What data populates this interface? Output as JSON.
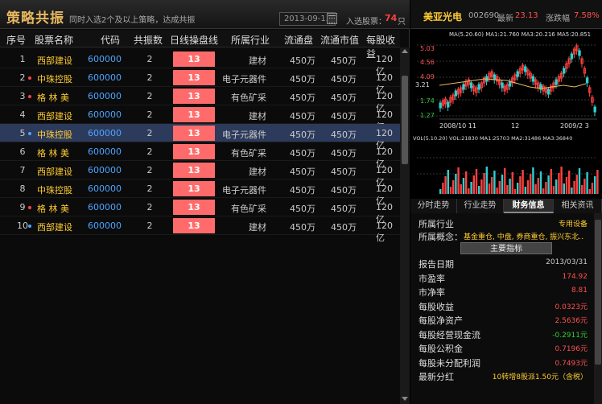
{
  "header": {
    "title": "策略共振",
    "subtitle": "同时入选2个及以上策略，达成共振",
    "date": "2013-09-13",
    "selected_label": "入选股票：",
    "selected_count": "74",
    "selected_unit": "只"
  },
  "columns": [
    "序号",
    "股票名称",
    "代码",
    "共振数",
    "日线操盘线",
    "所属行业",
    "流通盘",
    "流通市值",
    "每股收益"
  ],
  "rows": [
    {
      "idx": "1",
      "dot": "",
      "name": "西部建设",
      "code": "600000",
      "amp": "2",
      "op": "13",
      "industry": "建材",
      "float": "450万",
      "mv": "450万",
      "eps": "120亿"
    },
    {
      "idx": "2",
      "dot": "#ff4444",
      "name": "中珠控股",
      "code": "600000",
      "amp": "2",
      "op": "13",
      "industry": "电子元器件",
      "float": "450万",
      "mv": "450万",
      "eps": "120亿"
    },
    {
      "idx": "3",
      "dot": "#ff4444",
      "name": "格 林 美",
      "code": "600000",
      "amp": "2",
      "op": "13",
      "industry": "有色矿采",
      "float": "450万",
      "mv": "450万",
      "eps": "120亿"
    },
    {
      "idx": "4",
      "dot": "",
      "name": "西部建设",
      "code": "600000",
      "amp": "2",
      "op": "13",
      "industry": "建材",
      "float": "450万",
      "mv": "450万",
      "eps": "120亿"
    },
    {
      "idx": "5",
      "dot": "#4ea4ff",
      "name": "中珠控股",
      "code": "600000",
      "amp": "2",
      "op": "13",
      "industry": "电子元器件",
      "float": "450万",
      "mv": "450万",
      "eps": "120亿"
    },
    {
      "idx": "6",
      "dot": "",
      "name": "格 林 美",
      "code": "600000",
      "amp": "2",
      "op": "13",
      "industry": "有色矿采",
      "float": "450万",
      "mv": "450万",
      "eps": "120亿"
    },
    {
      "idx": "7",
      "dot": "",
      "name": "西部建设",
      "code": "600000",
      "amp": "2",
      "op": "13",
      "industry": "建材",
      "float": "450万",
      "mv": "450万",
      "eps": "120亿"
    },
    {
      "idx": "8",
      "dot": "",
      "name": "中珠控股",
      "code": "600000",
      "amp": "2",
      "op": "13",
      "industry": "电子元器件",
      "float": "450万",
      "mv": "450万",
      "eps": "120亿"
    },
    {
      "idx": "9",
      "dot": "#ff4444",
      "name": "格 林 美",
      "code": "600000",
      "amp": "2",
      "op": "13",
      "industry": "有色矿采",
      "float": "450万",
      "mv": "450万",
      "eps": "120亿"
    },
    {
      "idx": "10",
      "dot": "#4ea4ff",
      "name": "西部建设",
      "code": "600000",
      "amp": "2",
      "op": "13",
      "industry": "建材",
      "float": "450万",
      "mv": "450万",
      "eps": "120亿"
    }
  ],
  "selected_row": 5,
  "stock": {
    "name": "美亚光电",
    "code": "002690",
    "last_label": "最新",
    "last": "23.13",
    "chg_label": "涨跌幅",
    "chg": "7.58%"
  },
  "kline": {
    "ma_line": "MA(5.20.60) MA1:21.760 MA3:20.216 MA5:20.851",
    "prices": [
      "5.03",
      "4.56",
      "4.09",
      "3.21",
      "1.74",
      "1.27"
    ],
    "dates": [
      "2008/10 11",
      "12",
      "2009/2 3"
    ],
    "vol_line": "VOL(5.10.20) VOL:21830 MA1:25703 MA2:31486 MA3:36840"
  },
  "tabs": [
    "分时走势",
    "行业走势",
    "财务信息",
    "相关资讯"
  ],
  "active_tab": 2,
  "info": {
    "industry_label": "所属行业",
    "industry": "专用设备",
    "concept_label": "所属概念：",
    "concept": "基金重仓, 中盘, 券商重仓, 振兴东北...",
    "section": "主要指标",
    "items": [
      {
        "label": "报告日期",
        "value": "2013/03/31",
        "color": "#ccc"
      },
      {
        "label": "市盈率",
        "value": "174.92",
        "color": "#ff5050"
      },
      {
        "label": "市净率",
        "value": "8.81",
        "color": "#ff5050"
      },
      {
        "label": "每股收益",
        "value": "0.0323元",
        "color": "#ff5050"
      },
      {
        "label": "每股净资产",
        "value": "2.5636元",
        "color": "#ff5050"
      },
      {
        "label": "每股经营现金流",
        "value": "-0.2911元",
        "color": "#33cc33"
      },
      {
        "label": "每股公积金",
        "value": "0.7196元",
        "color": "#ff5050"
      },
      {
        "label": "每股未分配利润",
        "value": "0.7493元",
        "color": "#ff5050"
      },
      {
        "label": "最新分红",
        "value": "10转增8股派1.50元（含税）",
        "color": "#ffcc33"
      }
    ]
  }
}
